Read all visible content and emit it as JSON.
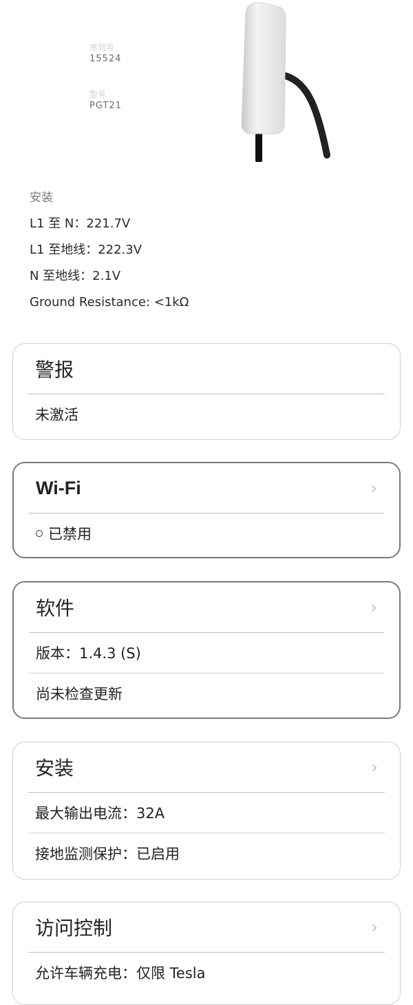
{
  "device": {
    "serial_label_1": "序列号",
    "serial_value_1": "15524",
    "serial_label_2": "型号",
    "serial_value_2": "PGT21"
  },
  "installation_info": {
    "title": "安装",
    "lines": [
      "L1 至 N：221.7V",
      "L1 至地线：222.3V",
      "N 至地线：2.1V",
      "Ground Resistance: <1kΩ"
    ]
  },
  "cards": {
    "alerts": {
      "title": "警报",
      "rows": [
        "未激活"
      ]
    },
    "wifi": {
      "title": "Wi-Fi",
      "status": "已禁用"
    },
    "software": {
      "title": "软件",
      "rows": [
        "版本：1.4.3 (S)",
        "尚未检查更新"
      ]
    },
    "install": {
      "title": "安装",
      "rows": [
        "最大输出电流：32A",
        "接地监测保护：已启用"
      ]
    },
    "access": {
      "title": "访问控制",
      "rows": [
        "允许车辆充电：仅限 Tesla"
      ]
    }
  },
  "icons": {
    "chevron": "chevron-right-icon",
    "status": "status-circle-icon",
    "charger": "wall-connector-image"
  }
}
